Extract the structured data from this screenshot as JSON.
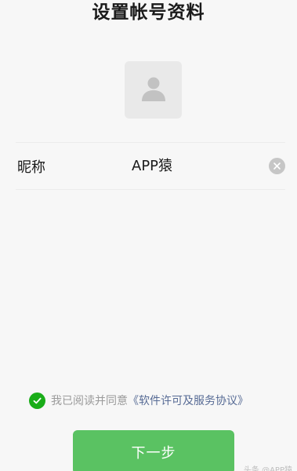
{
  "title": "设置帐号资料",
  "avatar": {
    "icon": "user-placeholder-icon"
  },
  "nickname": {
    "label": "昵称",
    "value": "APP猿",
    "clear_icon": "clear-icon"
  },
  "agreement": {
    "checked": true,
    "check_icon": "check-circle-icon",
    "prefix": "我已阅读并同意",
    "link_text": "《软件许可及服务协议》"
  },
  "next_button": {
    "label": "下一步"
  },
  "watermark": "头条 @APP猿",
  "colors": {
    "accent_green": "#5ac262",
    "check_green": "#1aad19",
    "link_blue": "#576b95"
  }
}
